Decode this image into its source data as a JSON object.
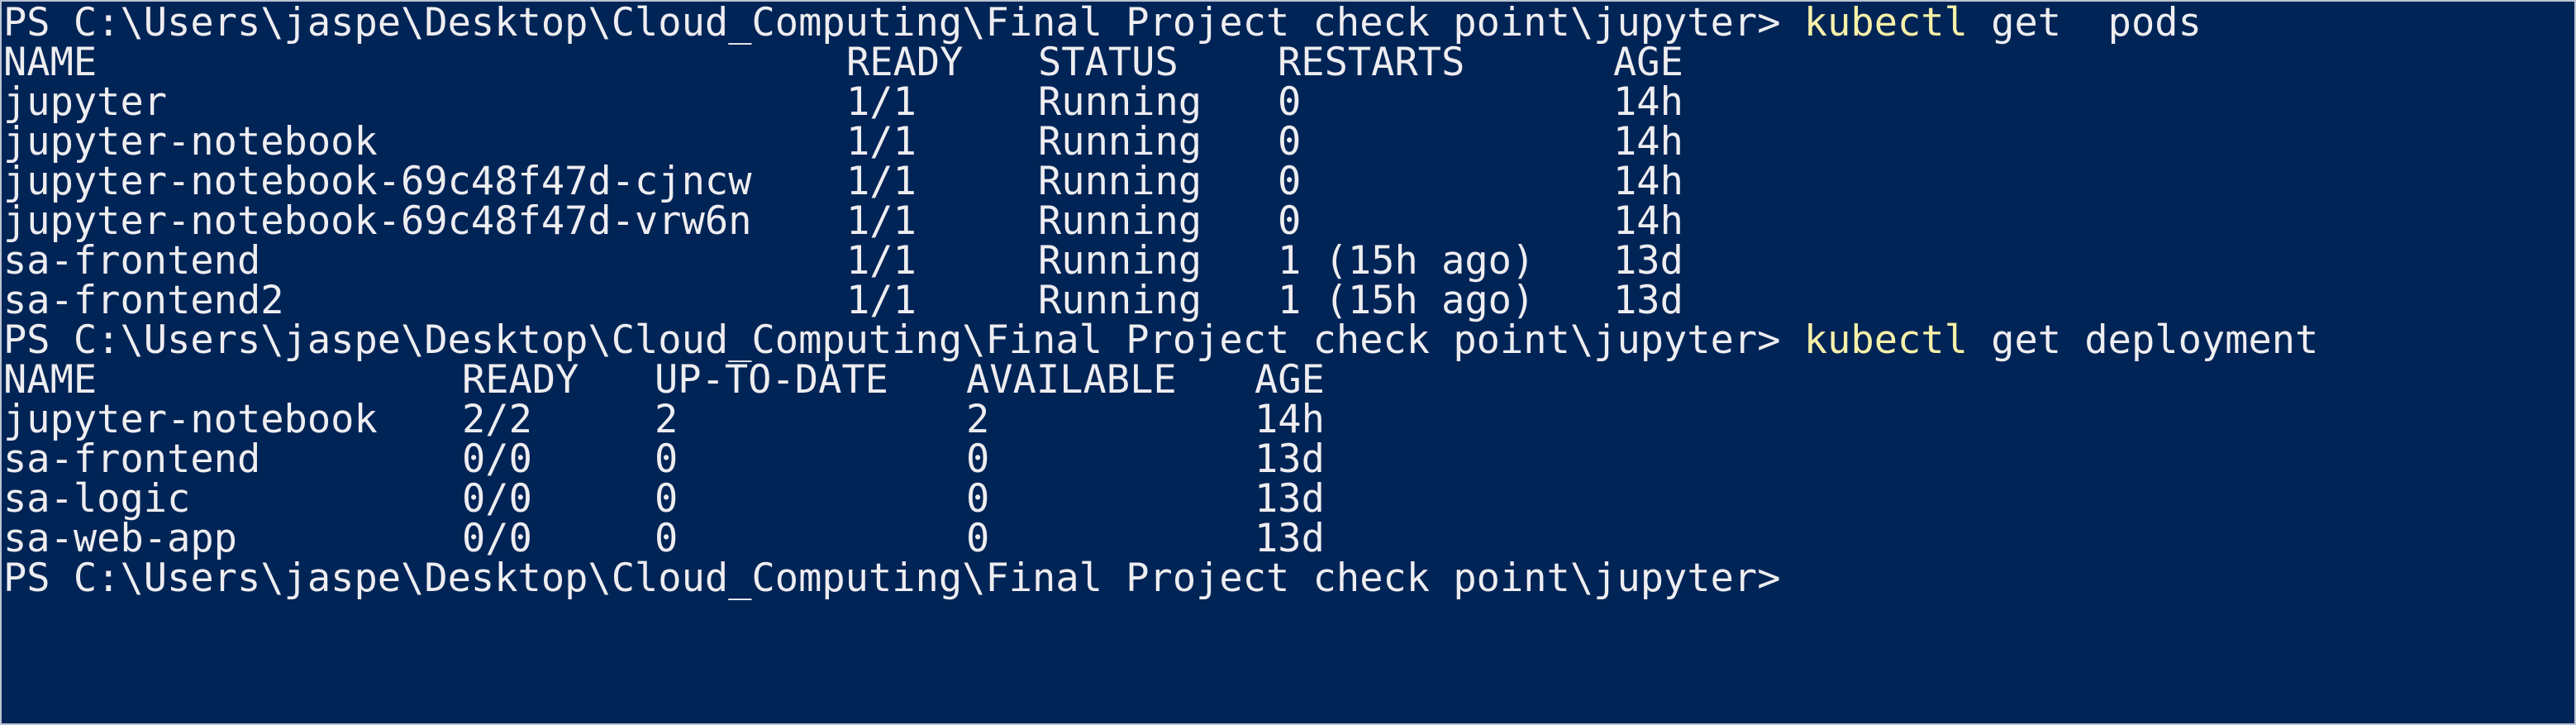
{
  "prompt_text": "PS C:\\Users\\jaspe\\Desktop\\Cloud_Computing\\Final Project check point\\jupyter> ",
  "cmd1": {
    "keyword": "kubectl",
    "args": " get  pods"
  },
  "pods": {
    "headers": [
      "NAME",
      "READY",
      "STATUS",
      "RESTARTS",
      "AGE"
    ],
    "rows": [
      [
        "jupyter",
        "1/1",
        "Running",
        "0",
        "14h"
      ],
      [
        "jupyter-notebook",
        "1/1",
        "Running",
        "0",
        "14h"
      ],
      [
        "jupyter-notebook-69c48f47d-cjncw",
        "1/1",
        "Running",
        "0",
        "14h"
      ],
      [
        "jupyter-notebook-69c48f47d-vrw6n",
        "1/1",
        "Running",
        "0",
        "14h"
      ],
      [
        "sa-frontend",
        "1/1",
        "Running",
        "1 (15h ago)",
        "13d"
      ],
      [
        "sa-frontend2",
        "1/1",
        "Running",
        "1 (15h ago)",
        "13d"
      ]
    ]
  },
  "cmd2": {
    "keyword": "kubectl",
    "args": " get deployment"
  },
  "deployments": {
    "headers": [
      "NAME",
      "READY",
      "UP-TO-DATE",
      "AVAILABLE",
      "AGE"
    ],
    "rows": [
      [
        "jupyter-notebook",
        "2/2",
        "2",
        "2",
        "14h"
      ],
      [
        "sa-frontend",
        "0/0",
        "0",
        "0",
        "13d"
      ],
      [
        "sa-logic",
        "0/0",
        "0",
        "0",
        "13d"
      ],
      [
        "sa-web-app",
        "0/0",
        "0",
        "0",
        "13d"
      ]
    ]
  },
  "colors": {
    "background": "#012456",
    "text": "#eeedf0",
    "command": "#f7f1a8"
  }
}
